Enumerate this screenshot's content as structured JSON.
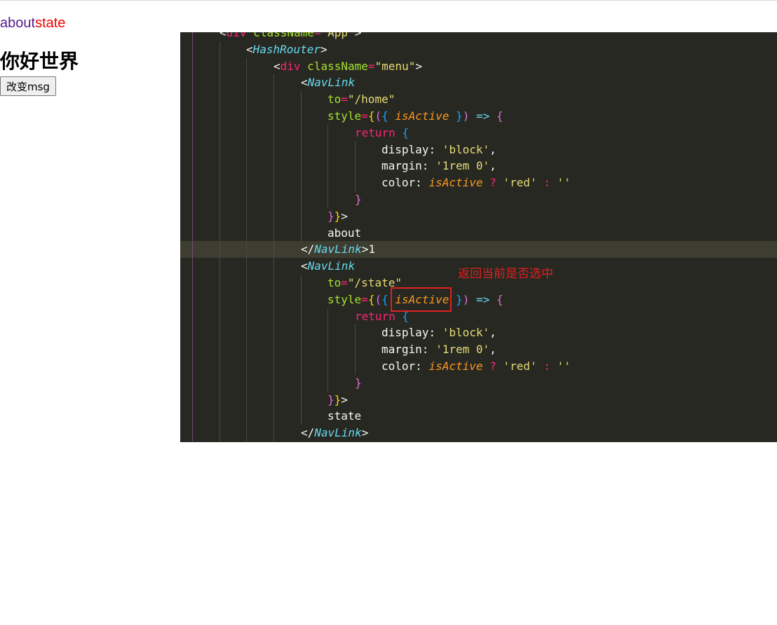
{
  "nav": {
    "link_about": "about",
    "link_state": "state"
  },
  "heading": "你好世界",
  "button_label": "改变msg",
  "annotation": "返回当前是否选中",
  "colors": {
    "link_about": "#551a8b",
    "link_active": "#ee0000",
    "editor_bg": "#272822",
    "annotation": "#e02020"
  },
  "code": {
    "l0": {
      "a": "<",
      "b": "div",
      "c": " className",
      "d": "=",
      "e": "\"App\"",
      "f": ">"
    },
    "l1": {
      "a": "<",
      "b": "HashRouter",
      "c": ">"
    },
    "l2": {
      "a": "<",
      "b": "div",
      "c": " className",
      "d": "=",
      "e": "\"menu\"",
      "f": ">"
    },
    "l3": {
      "a": "<",
      "b": "NavLink"
    },
    "l4": {
      "a": "to",
      "b": "=",
      "c": "\"/home\""
    },
    "l5": {
      "a": "style",
      "b": "=",
      "c": "{",
      "d": "(",
      "e": "{ ",
      "f": "isActive",
      "g": " }",
      "h": ")",
      "i": " => ",
      "j": "{"
    },
    "l6": {
      "a": "return",
      "b": " {"
    },
    "l7": {
      "a": "display",
      "b": ": ",
      "c": "'block'",
      "d": ","
    },
    "l8": {
      "a": "margin",
      "b": ": ",
      "c": "'1rem 0'",
      "d": ","
    },
    "l9": {
      "a": "color",
      "b": ": ",
      "c": "isActive",
      "d": " ? ",
      "e": "'red'",
      "f": " : ",
      "g": "''"
    },
    "l10": {
      "a": "}"
    },
    "l11": {
      "a": "}",
      "b": "}",
      "c": ">"
    },
    "l12": {
      "a": "about"
    },
    "l13": {
      "a": "</",
      "b": "NavLink",
      "c": ">",
      "d": "1"
    },
    "l14": {
      "a": "<",
      "b": "NavLink"
    },
    "l15": {
      "a": "to",
      "b": "=",
      "c": "\"/state\""
    },
    "l16": {
      "a": "style",
      "b": "=",
      "c": "{",
      "d": "(",
      "e": "{ ",
      "f": "isActive",
      "g": " }",
      "h": ")",
      "i": " => ",
      "j": "{"
    },
    "l17": {
      "a": "return",
      "b": " {"
    },
    "l18": {
      "a": "display",
      "b": ": ",
      "c": "'block'",
      "d": ","
    },
    "l19": {
      "a": "margin",
      "b": ": ",
      "c": "'1rem 0'",
      "d": ","
    },
    "l20": {
      "a": "color",
      "b": ": ",
      "c": "isActive",
      "d": " ? ",
      "e": "'red'",
      "f": " : ",
      "g": "''"
    },
    "l21": {
      "a": "}"
    },
    "l22": {
      "a": "}",
      "b": "}",
      "c": ">"
    },
    "l23": {
      "a": "state"
    },
    "l24": {
      "a": "</",
      "b": "NavLink",
      "c": ">"
    }
  }
}
